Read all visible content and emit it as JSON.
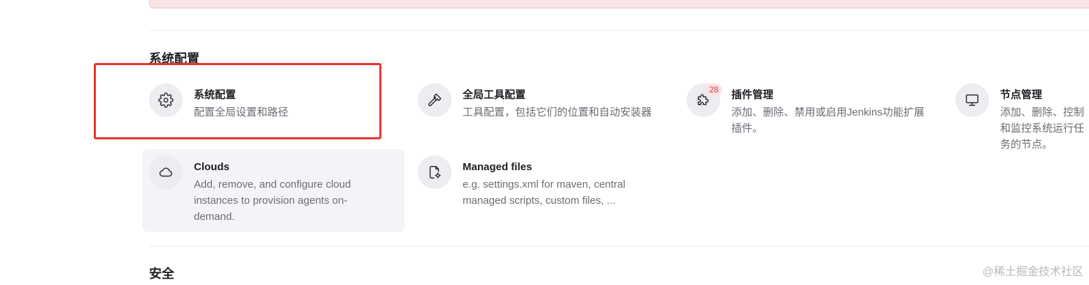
{
  "sections": [
    {
      "title": "系统配置",
      "items": [
        {
          "title": "系统配置",
          "description": "配置全局设置和路径",
          "icon": "gear-icon"
        },
        {
          "title": "全局工具配置",
          "description": "工具配置，包括它们的位置和自动安装器",
          "icon": "hammer-icon"
        },
        {
          "title": "插件管理",
          "description": "添加、删除、禁用或启用Jenkins功能扩展插件。",
          "icon": "puzzle-icon",
          "badge": "28"
        },
        {
          "title": "节点管理",
          "description": "添加、删除、控制和监控系统运行任务的节点。",
          "icon": "monitor-icon"
        },
        {
          "title": "Clouds",
          "description": "Add, remove, and configure cloud instances to provision agents on-demand.",
          "icon": "cloud-icon"
        },
        {
          "title": "Managed files",
          "description": "e.g. settings.xml for maven, central managed scripts, custom files, ...",
          "icon": "file-gear-icon"
        }
      ]
    },
    {
      "title": "安全"
    }
  ],
  "highlight": {
    "color": "#e8322d",
    "target": "系统配置"
  },
  "watermark": "@稀土掘金技术社区",
  "colors": {
    "badge_text": "#d6453d",
    "badge_bg": "#fbe3e4",
    "alert_bg": "#f8e4e5",
    "icon_bg": "#ececf1",
    "hover_bg": "#f4f4f8"
  }
}
